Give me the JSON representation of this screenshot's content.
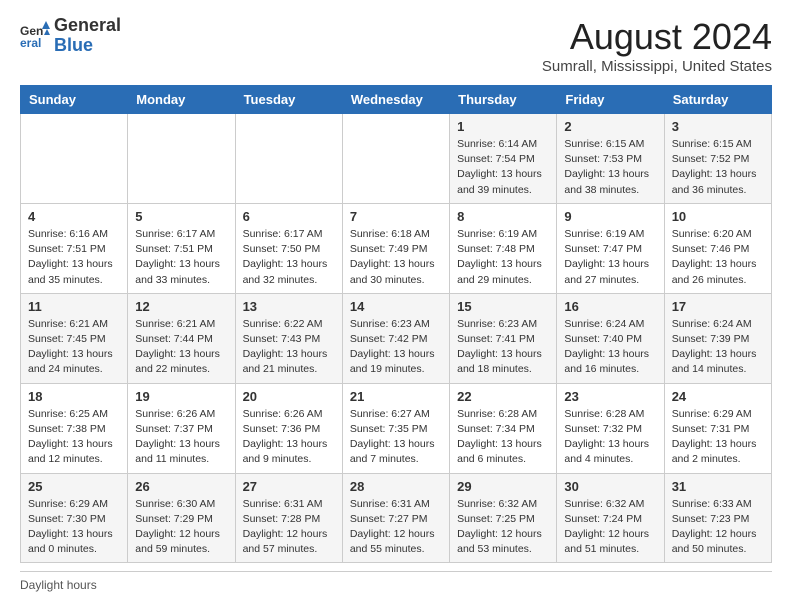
{
  "header": {
    "logo_general": "General",
    "logo_blue": "Blue",
    "main_title": "August 2024",
    "subtitle": "Sumrall, Mississippi, United States"
  },
  "days_of_week": [
    "Sunday",
    "Monday",
    "Tuesday",
    "Wednesday",
    "Thursday",
    "Friday",
    "Saturday"
  ],
  "weeks": [
    [
      {
        "day": "",
        "info": ""
      },
      {
        "day": "",
        "info": ""
      },
      {
        "day": "",
        "info": ""
      },
      {
        "day": "",
        "info": ""
      },
      {
        "day": "1",
        "info": "Sunrise: 6:14 AM\nSunset: 7:54 PM\nDaylight: 13 hours and 39 minutes."
      },
      {
        "day": "2",
        "info": "Sunrise: 6:15 AM\nSunset: 7:53 PM\nDaylight: 13 hours and 38 minutes."
      },
      {
        "day": "3",
        "info": "Sunrise: 6:15 AM\nSunset: 7:52 PM\nDaylight: 13 hours and 36 minutes."
      }
    ],
    [
      {
        "day": "4",
        "info": "Sunrise: 6:16 AM\nSunset: 7:51 PM\nDaylight: 13 hours and 35 minutes."
      },
      {
        "day": "5",
        "info": "Sunrise: 6:17 AM\nSunset: 7:51 PM\nDaylight: 13 hours and 33 minutes."
      },
      {
        "day": "6",
        "info": "Sunrise: 6:17 AM\nSunset: 7:50 PM\nDaylight: 13 hours and 32 minutes."
      },
      {
        "day": "7",
        "info": "Sunrise: 6:18 AM\nSunset: 7:49 PM\nDaylight: 13 hours and 30 minutes."
      },
      {
        "day": "8",
        "info": "Sunrise: 6:19 AM\nSunset: 7:48 PM\nDaylight: 13 hours and 29 minutes."
      },
      {
        "day": "9",
        "info": "Sunrise: 6:19 AM\nSunset: 7:47 PM\nDaylight: 13 hours and 27 minutes."
      },
      {
        "day": "10",
        "info": "Sunrise: 6:20 AM\nSunset: 7:46 PM\nDaylight: 13 hours and 26 minutes."
      }
    ],
    [
      {
        "day": "11",
        "info": "Sunrise: 6:21 AM\nSunset: 7:45 PM\nDaylight: 13 hours and 24 minutes."
      },
      {
        "day": "12",
        "info": "Sunrise: 6:21 AM\nSunset: 7:44 PM\nDaylight: 13 hours and 22 minutes."
      },
      {
        "day": "13",
        "info": "Sunrise: 6:22 AM\nSunset: 7:43 PM\nDaylight: 13 hours and 21 minutes."
      },
      {
        "day": "14",
        "info": "Sunrise: 6:23 AM\nSunset: 7:42 PM\nDaylight: 13 hours and 19 minutes."
      },
      {
        "day": "15",
        "info": "Sunrise: 6:23 AM\nSunset: 7:41 PM\nDaylight: 13 hours and 18 minutes."
      },
      {
        "day": "16",
        "info": "Sunrise: 6:24 AM\nSunset: 7:40 PM\nDaylight: 13 hours and 16 minutes."
      },
      {
        "day": "17",
        "info": "Sunrise: 6:24 AM\nSunset: 7:39 PM\nDaylight: 13 hours and 14 minutes."
      }
    ],
    [
      {
        "day": "18",
        "info": "Sunrise: 6:25 AM\nSunset: 7:38 PM\nDaylight: 13 hours and 12 minutes."
      },
      {
        "day": "19",
        "info": "Sunrise: 6:26 AM\nSunset: 7:37 PM\nDaylight: 13 hours and 11 minutes."
      },
      {
        "day": "20",
        "info": "Sunrise: 6:26 AM\nSunset: 7:36 PM\nDaylight: 13 hours and 9 minutes."
      },
      {
        "day": "21",
        "info": "Sunrise: 6:27 AM\nSunset: 7:35 PM\nDaylight: 13 hours and 7 minutes."
      },
      {
        "day": "22",
        "info": "Sunrise: 6:28 AM\nSunset: 7:34 PM\nDaylight: 13 hours and 6 minutes."
      },
      {
        "day": "23",
        "info": "Sunrise: 6:28 AM\nSunset: 7:32 PM\nDaylight: 13 hours and 4 minutes."
      },
      {
        "day": "24",
        "info": "Sunrise: 6:29 AM\nSunset: 7:31 PM\nDaylight: 13 hours and 2 minutes."
      }
    ],
    [
      {
        "day": "25",
        "info": "Sunrise: 6:29 AM\nSunset: 7:30 PM\nDaylight: 13 hours and 0 minutes."
      },
      {
        "day": "26",
        "info": "Sunrise: 6:30 AM\nSunset: 7:29 PM\nDaylight: 12 hours and 59 minutes."
      },
      {
        "day": "27",
        "info": "Sunrise: 6:31 AM\nSunset: 7:28 PM\nDaylight: 12 hours and 57 minutes."
      },
      {
        "day": "28",
        "info": "Sunrise: 6:31 AM\nSunset: 7:27 PM\nDaylight: 12 hours and 55 minutes."
      },
      {
        "day": "29",
        "info": "Sunrise: 6:32 AM\nSunset: 7:25 PM\nDaylight: 12 hours and 53 minutes."
      },
      {
        "day": "30",
        "info": "Sunrise: 6:32 AM\nSunset: 7:24 PM\nDaylight: 12 hours and 51 minutes."
      },
      {
        "day": "31",
        "info": "Sunrise: 6:33 AM\nSunset: 7:23 PM\nDaylight: 12 hours and 50 minutes."
      }
    ]
  ],
  "footer": {
    "daylight_label": "Daylight hours"
  }
}
